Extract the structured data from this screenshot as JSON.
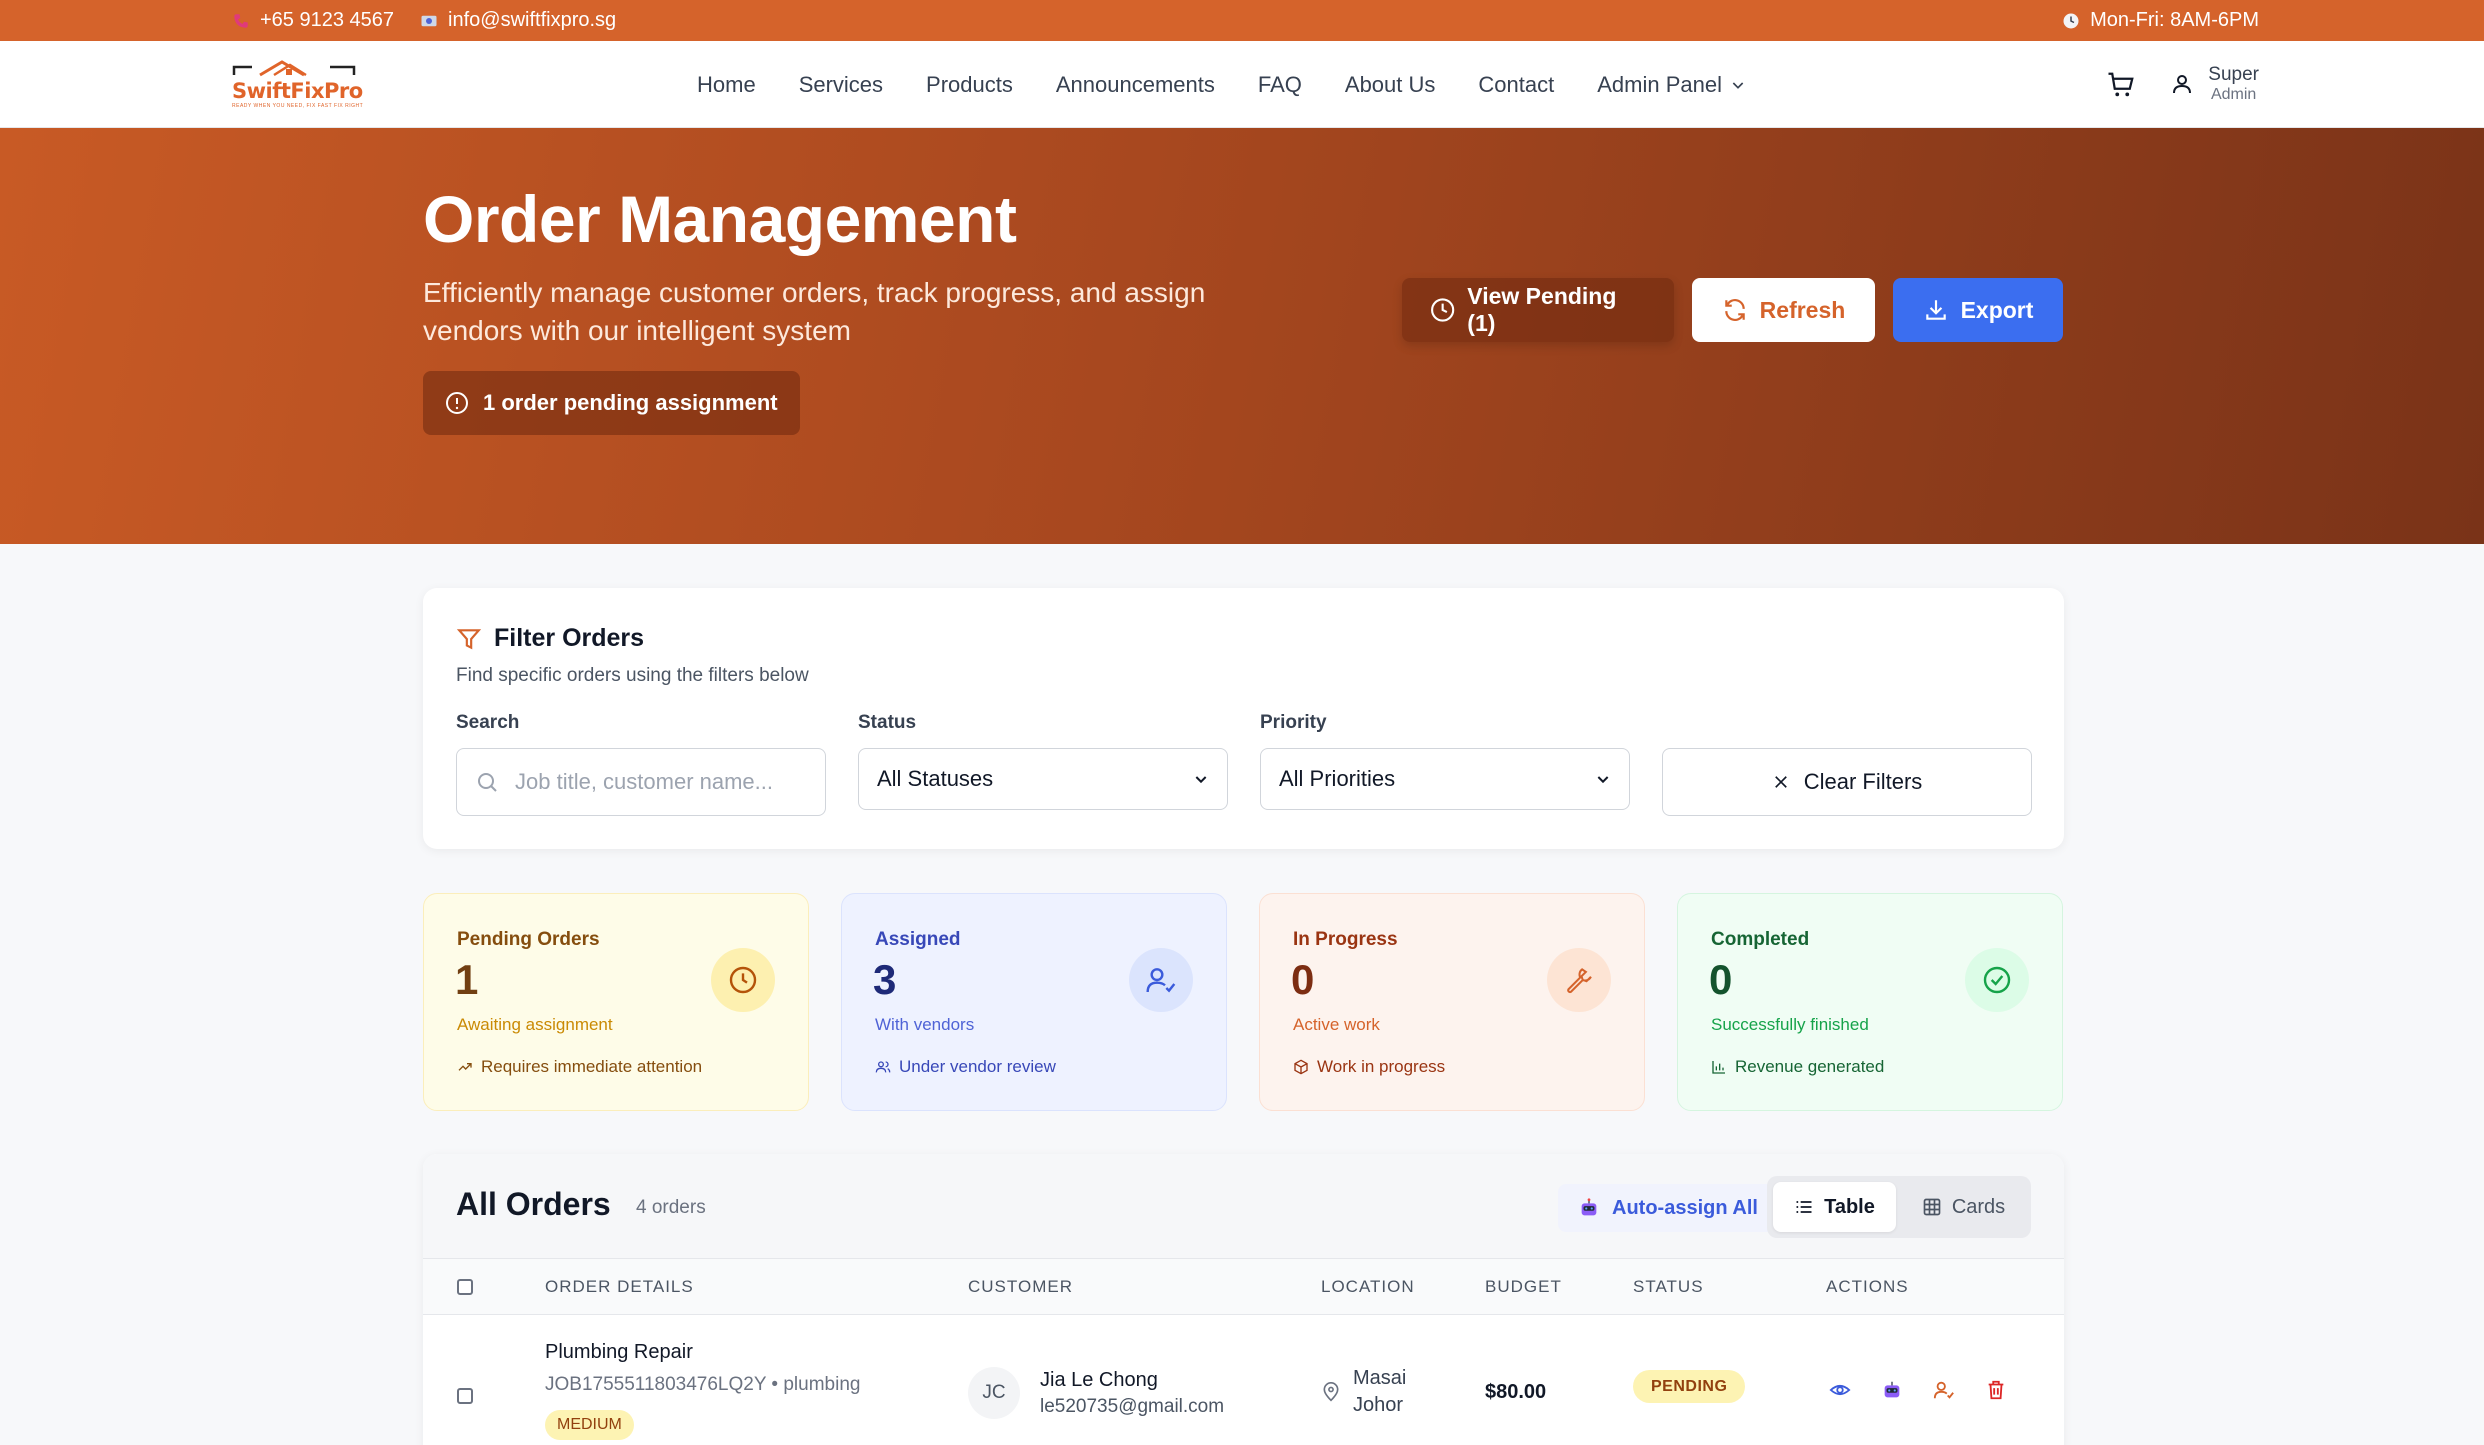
{
  "topbar": {
    "phone": "+65 9123 4567",
    "email": "info@swiftfixpro.sg",
    "hours": "Mon-Fri: 8AM-6PM"
  },
  "brand": {
    "name": "SwiftFixPro",
    "tagline": "READY WHEN YOU NEED, FIX FAST FIX RIGHT",
    "color": "#d5632b"
  },
  "nav": {
    "links": [
      "Home",
      "Services",
      "Products",
      "Announcements",
      "FAQ",
      "About Us",
      "Contact",
      "Admin Panel"
    ],
    "user_first": "Super",
    "user_role": "Admin"
  },
  "hero": {
    "title": "Order Management",
    "subtitle": "Efficiently manage customer orders, track progress, and assign vendors with our intelligent system",
    "pending_notice": "1 order pending assignment",
    "view_pending_label": "View Pending (1)",
    "refresh_label": "Refresh",
    "export_label": "Export"
  },
  "filters": {
    "title": "Filter Orders",
    "subtitle": "Find specific orders using the filters below",
    "search_label": "Search",
    "search_placeholder": "Job title, customer name...",
    "status_label": "Status",
    "status_value": "All Statuses",
    "priority_label": "Priority",
    "priority_value": "All Priorities",
    "clear_label": "Clear Filters"
  },
  "stats": [
    {
      "label": "Pending Orders",
      "value": "1",
      "sub": "Awaiting assignment",
      "foot": "Requires immediate attention",
      "icon": "clock-icon"
    },
    {
      "label": "Assigned",
      "value": "3",
      "sub": "With vendors",
      "foot": "Under vendor review",
      "icon": "user-check-icon"
    },
    {
      "label": "In Progress",
      "value": "0",
      "sub": "Active work",
      "foot": "Work in progress",
      "icon": "wrench-icon"
    },
    {
      "label": "Completed",
      "value": "0",
      "sub": "Successfully finished",
      "foot": "Revenue generated",
      "icon": "check-circle-icon"
    }
  ],
  "orders": {
    "title": "All Orders",
    "count": "4 orders",
    "auto_assign_label": "Auto-assign All",
    "view_table": "Table",
    "view_cards": "Cards",
    "columns": [
      "ORDER DETAILS",
      "CUSTOMER",
      "LOCATION",
      "BUDGET",
      "STATUS",
      "ACTIONS"
    ],
    "rows": [
      {
        "title": "Plumbing Repair",
        "meta": "JOB1755511803476LQ2Y • plumbing",
        "priority": "MEDIUM",
        "initials": "JC",
        "customer": "Jia Le Chong",
        "email": "le520735@gmail.com",
        "location_line1": "Masai",
        "location_line2": "Johor",
        "budget": "$80.00",
        "status": "PENDING"
      }
    ]
  }
}
